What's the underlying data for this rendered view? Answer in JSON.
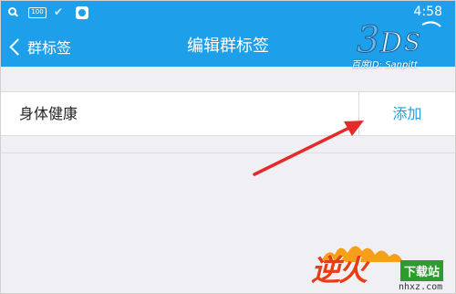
{
  "status_bar": {
    "time": "4:58",
    "box_icon_text": "100"
  },
  "nav": {
    "back_label": "群标签",
    "title": "编辑群标签"
  },
  "tags": [
    {
      "name": "身体健康",
      "action_label": "添加"
    }
  ],
  "watermarks": {
    "top_text": "百度ID: Sanpitt",
    "bottom_logo": "逆火",
    "bottom_badge": "下载站",
    "bottom_domain": "nhxz.com"
  },
  "colors": {
    "primary": "#1da0e9",
    "arrow": "#e52a2a"
  }
}
